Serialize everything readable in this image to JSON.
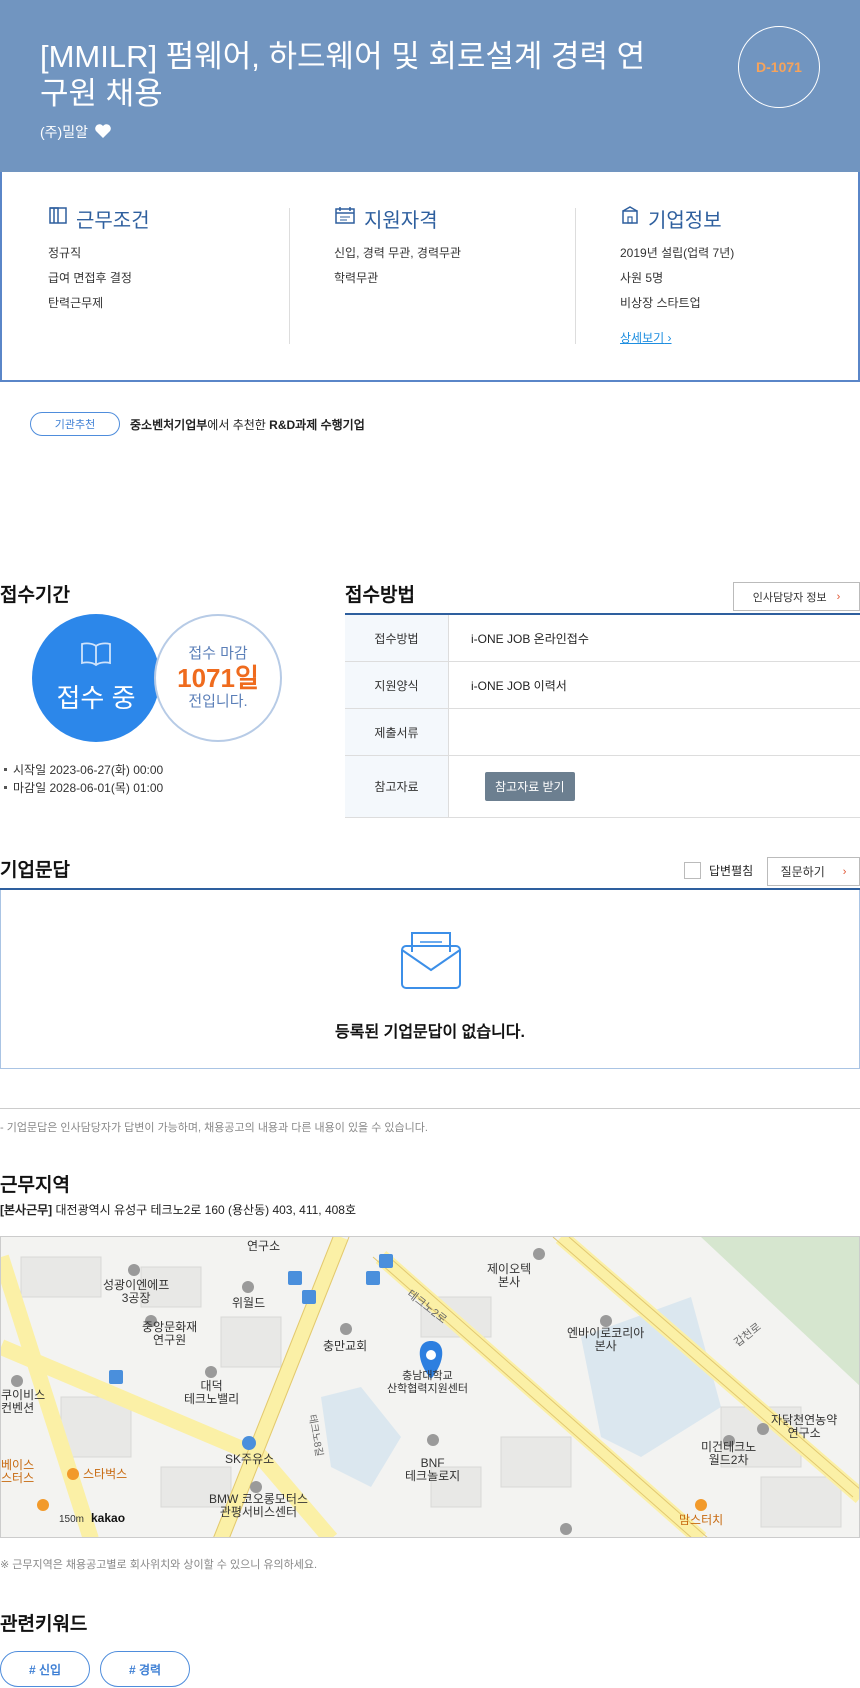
{
  "header": {
    "title": "[MMILR] 펌웨어, 하드웨어 및 회로설계 경력 연구원 채용",
    "company": "(주)밀알",
    "dday": "D-1071"
  },
  "info": {
    "conditions": {
      "title": "근무조건",
      "lines": [
        "정규직",
        "급여 면접후 결정",
        "탄력근무제"
      ]
    },
    "qualifications": {
      "title": "지원자격",
      "lines": [
        "신입, 경력 무관, 경력무관",
        "학력무관"
      ]
    },
    "company_info": {
      "title": "기업정보",
      "lines": [
        "2019년 설립(업력 7년)",
        "사원 5명",
        "비상장 스타트업"
      ],
      "more_label": "상세보기",
      "more_arrow": "›"
    }
  },
  "recommend": {
    "badge": "기관추천",
    "org": "중소벤처기업부",
    "mid": "에서 추천한 ",
    "task": "R&D과제 수행기업"
  },
  "period": {
    "title": "접수기간",
    "status": "접수 중",
    "deadline_label": "접수 마감",
    "days_left": "1071일",
    "before_label": "전입니다.",
    "start": "시작일 2023-06-27(화) 00:00",
    "end": "마감일 2028-06-01(목) 01:00"
  },
  "method": {
    "title": "접수방법",
    "hr_button": "인사담당자 정보",
    "arrow": "›",
    "rows": [
      {
        "label": "접수방법",
        "value": "i-ONE JOB 온라인접수"
      },
      {
        "label": "지원양식",
        "value": "i-ONE JOB 이력서"
      },
      {
        "label": "제출서류",
        "value": ""
      },
      {
        "label": "참고자료",
        "button": "참고자료 받기"
      }
    ]
  },
  "qa": {
    "title": "기업문답",
    "toggle_label": "답변펼침",
    "ask_button": "질문하기",
    "arrow": "›",
    "empty": "등록된 기업문답이 없습니다.",
    "note": "- 기업문답은 인사담당자가 답변이 가능하며, 채용공고의 내용과 다른 내용이 있을 수 있습니다."
  },
  "location": {
    "title": "근무지역",
    "tag": "[본사근무]",
    "address": "대전광역시 유성구 테크노2로 160 (용산동) 403, 411, 408호",
    "note": "※ 근무지역은 채용공고별로 회사위치와 상이할 수 있으니 유의하세요.",
    "map_labels": {
      "lab_top": "연구소",
      "sungkwang": "성광이엔에프\n3공장",
      "wield": "위월드",
      "jeio": "제이오텍\n본사",
      "jungang": "중앙문화재\n연구원",
      "chungman": "충만교회",
      "road1": "테크노2로",
      "envio": "엔바이로코리아\n본사",
      "gapcheon": "갑천로",
      "target": "충남대학교\n산학협력지원센터",
      "daedeok": "대덕\n테크노밸리",
      "sk": "SK주유소",
      "bnf": "BNF\n테크놀로지",
      "road2": "테크노8길",
      "migun": "미건테크노\n월드2차",
      "jadal": "자닭천연농약\n연구소",
      "convention": "쿠이비스\n컨벤션",
      "starbucks": "스타벅스",
      "bmw": "BMW 코오롱모터스\n관평서비스센터",
      "moms": "맘스터치",
      "left_shop": "베이스\n스터스",
      "scale": "150m",
      "brand": "kakao"
    }
  },
  "keywords": {
    "title": "관련키워드",
    "items": [
      "# 신입",
      "# 경력"
    ]
  }
}
